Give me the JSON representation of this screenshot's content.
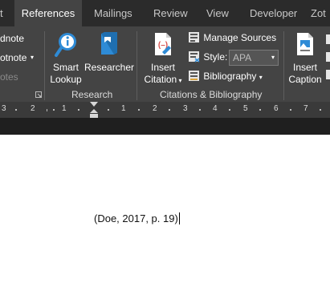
{
  "tabs": {
    "partial_left": "t",
    "references": "References",
    "mailings": "Mailings",
    "review": "Review",
    "view": "View",
    "developer": "Developer",
    "partial_right": "Zot"
  },
  "footnotes_group": {
    "endnote": "dnote",
    "footnote": "otnote",
    "notes": "otes"
  },
  "research": {
    "smart_lookup_line1": "Smart",
    "smart_lookup_line2": "Lookup",
    "researcher": "Researcher",
    "group_label": "Research"
  },
  "citations": {
    "insert_citation_line1": "Insert",
    "insert_citation_line2": "Citation",
    "manage_sources": "Manage Sources",
    "style_label": "Style:",
    "style_value": "APA",
    "bibliography": "Bibliography",
    "group_label": "Citations & Bibliography"
  },
  "captions": {
    "insert_caption_line1": "Insert",
    "insert_caption_line2": "Caption"
  },
  "ruler": {
    "left_numbers": [
      "3",
      "2",
      "1"
    ],
    "right_numbers": [
      "1",
      "2",
      "3",
      "4",
      "5",
      "6",
      "7"
    ]
  },
  "document": {
    "citation_text": "(Doe, 2017, p. 19)"
  },
  "colors": {
    "tabbar": "#2b2b2b",
    "ribbon": "#444444",
    "accent_blue": "#2e8bd6",
    "accent_red": "#d9534f"
  }
}
